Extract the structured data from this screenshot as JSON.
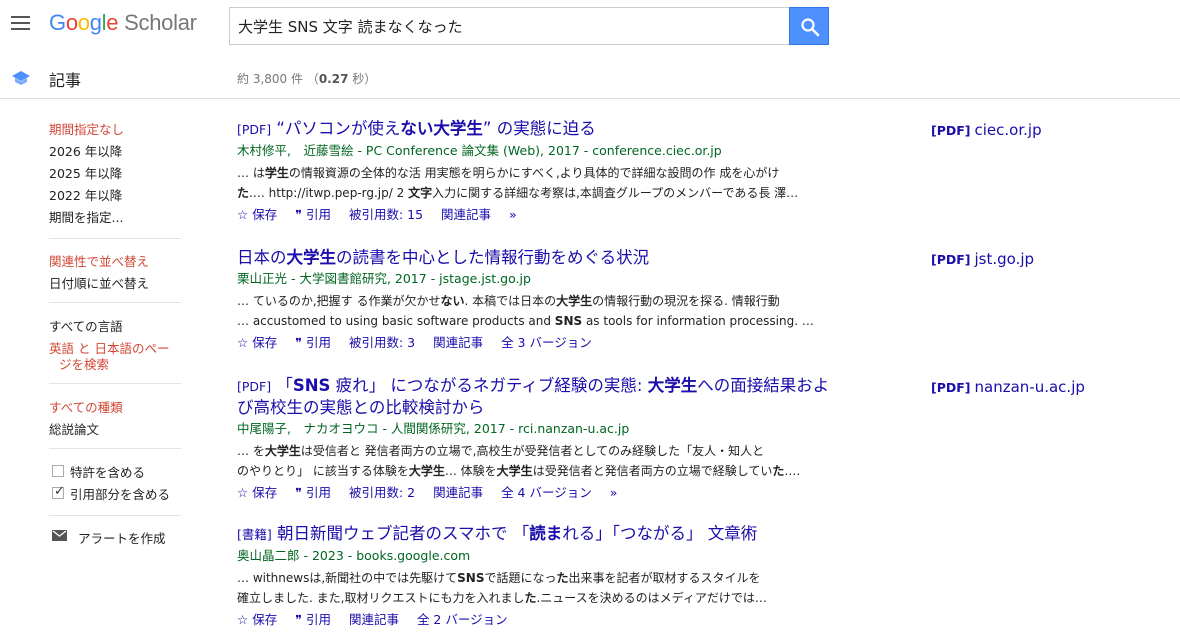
{
  "header": {
    "logo_google": [
      "G",
      "o",
      "o",
      "g",
      "l",
      "e"
    ],
    "logo_scholar": "Scholar",
    "search_value": "大学生 SNS 文字 読まなくなった"
  },
  "subheader": {
    "section_label": "記事",
    "stats_prefix": "約 3,800 件 （",
    "stats_time": "0.27",
    "stats_suffix": " 秒）"
  },
  "sidebar": {
    "time": [
      "期間指定なし",
      "2026 年以降",
      "2025 年以降",
      "2022 年以降",
      "期間を指定..."
    ],
    "sort": [
      "関連性で並べ替え",
      "日付順に並べ替え"
    ],
    "lang_all": "すべての言語",
    "lang_ja_1": "英語 と 日本語のペー",
    "lang_ja_2": "ジを検索",
    "type_all": "すべての種類",
    "type_review": "総説論文",
    "patents": "特許を含める",
    "citations": "引用部分を含める",
    "alert": "アラートを作成"
  },
  "results": [
    {
      "tag": "[PDF]",
      "title_parts": [
        "“パソコンが使え",
        "ない大学生",
        "” の実態に迫る"
      ],
      "meta": "木村修平,　近藤雪絵 - PC Conference 論文集 (Web), 2017 - conference.ciec.or.jp",
      "snippet1_parts": [
        "… は",
        "学生",
        "の情報資源の全体的な活 用実態を明らかにすべく,より具体的で詳細な設問の作 成を心がけ"
      ],
      "snippet2_parts": [
        "た",
        ".… http://itwp.pep-rg.jp/ 2 ",
        "文字",
        "入力に関する詳細な考察は,本調査グループのメンバーである長 澤…"
      ],
      "save": "保存",
      "cite": "引用",
      "cited_by": "被引用数: 15",
      "related": "関連記事",
      "versions": "",
      "side_tag": "[PDF]",
      "side_domain": "ciec.or.jp"
    },
    {
      "tag": "",
      "title_parts": [
        "日本の",
        "大学生",
        "の読書を中心とした情報行動をめぐる状況"
      ],
      "meta": "栗山正光 - 大学図書館研究, 2017 - jstage.jst.go.jp",
      "snippet1_parts": [
        "… ているのか,把握す る作業が欠かせ",
        "ない",
        ". 本稿では日本の",
        "大学生",
        "の情報行動の現況を探る. 情報行動"
      ],
      "snippet2_parts": [
        "… accustomed to using basic software products and ",
        "SNS",
        " as tools for information processing. …"
      ],
      "save": "保存",
      "cite": "引用",
      "cited_by": "被引用数: 3",
      "related": "関連記事",
      "versions": "全 3 バージョン",
      "side_tag": "[PDF]",
      "side_domain": "jst.go.jp"
    },
    {
      "tag": "[PDF]",
      "title_line1_parts": [
        "「",
        "SNS",
        " 疲れ」 につながるネガティブ経験の実態: ",
        "大学生",
        "への面接結果およ"
      ],
      "title_line2": "び高校生の実態との比較検討から",
      "meta": "中尾陽子,　ナカオヨウコ - 人間関係研究, 2017 - rci.nanzan-u.ac.jp",
      "snippet1_parts": [
        "… を",
        "大学生",
        "は受信者と 発信者両方の立場で,高校生が受発信者としてのみ経験した「友人・知人と"
      ],
      "snippet2_parts": [
        "のやりとり」 に該当する体験を",
        "大学生",
        "… 体験を",
        "大学生",
        "は受発信者と発信者両方の立場で経験してい",
        "た",
        "…."
      ],
      "save": "保存",
      "cite": "引用",
      "cited_by": "被引用数: 2",
      "related": "関連記事",
      "versions": "全 4 バージョン",
      "side_tag": "[PDF]",
      "side_domain": "nanzan-u.ac.jp"
    },
    {
      "tag": "[書籍]",
      "title_parts": [
        "朝日新聞ウェブ記者のスマホで 「",
        "読ま",
        "れる」「つながる」 文章術"
      ],
      "meta": "奥山晶二郎 - 2023 - books.google.com",
      "snippet1_parts": [
        "… withnewsは,新聞社の中では先駆けて",
        "SNS",
        "で話題になっ",
        "た",
        "出来事を記者が取材するスタイルを"
      ],
      "snippet2_parts": [
        "確立しました. また,取材リクエストにも力を入れまし",
        "た",
        ".ニュースを決めるのはメディアだけでは…"
      ],
      "save": "保存",
      "cite": "引用",
      "cited_by": "",
      "related": "関連記事",
      "versions": "全 2 バージョン",
      "side_tag": "",
      "side_domain": ""
    }
  ]
}
